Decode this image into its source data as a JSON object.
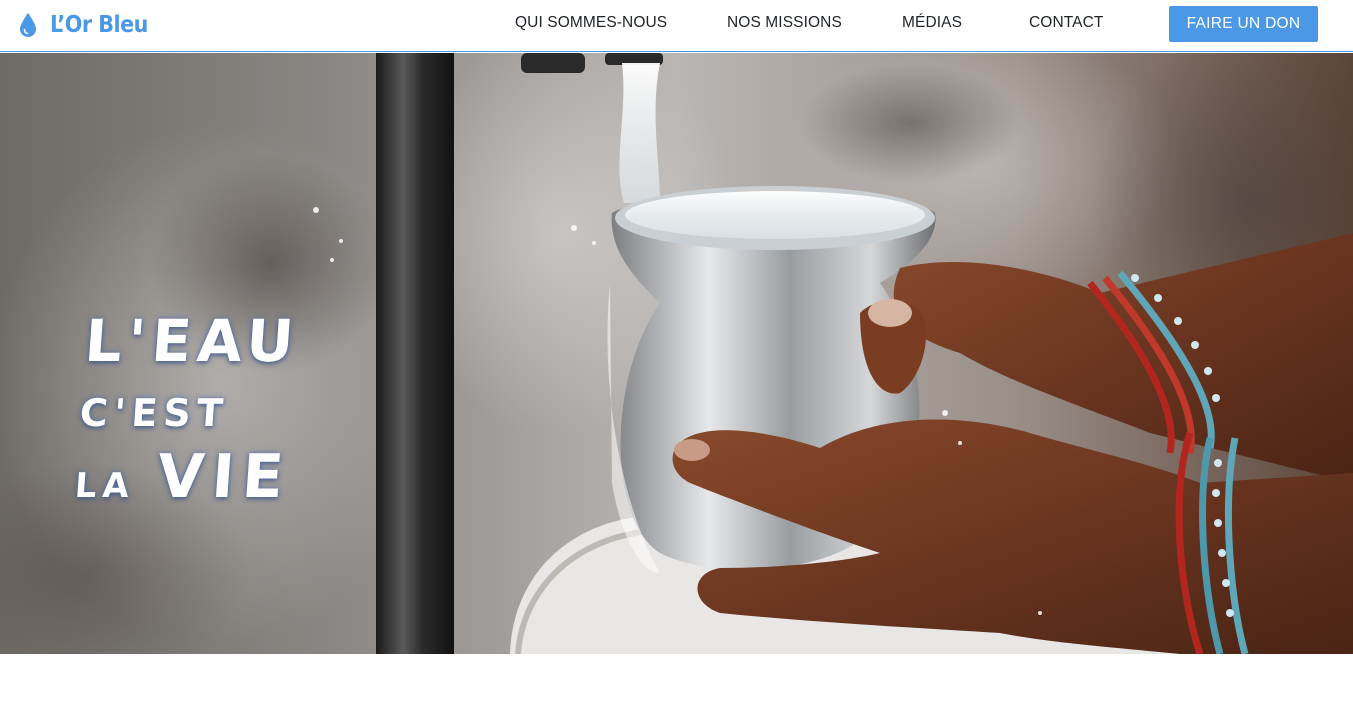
{
  "header": {
    "brand_name": "L’Or Bleu",
    "brand_icon": "water-drop-icon",
    "nav_items": [
      "QUI SOMMES-NOUS",
      "NOS MISSIONS",
      "MÉDIAS",
      "CONTACT"
    ],
    "donate_label": "FAIRE UN DON"
  },
  "hero": {
    "line1": "L'EAU",
    "line2": "C'EST",
    "line3_small": "LA",
    "line3_big": "VIE",
    "image": "photo of hands holding a silver pot filling with water from a tap"
  },
  "colors": {
    "accent": "#4a98e6",
    "nav_text": "#1f2328",
    "hero_text": "#ffffff"
  }
}
